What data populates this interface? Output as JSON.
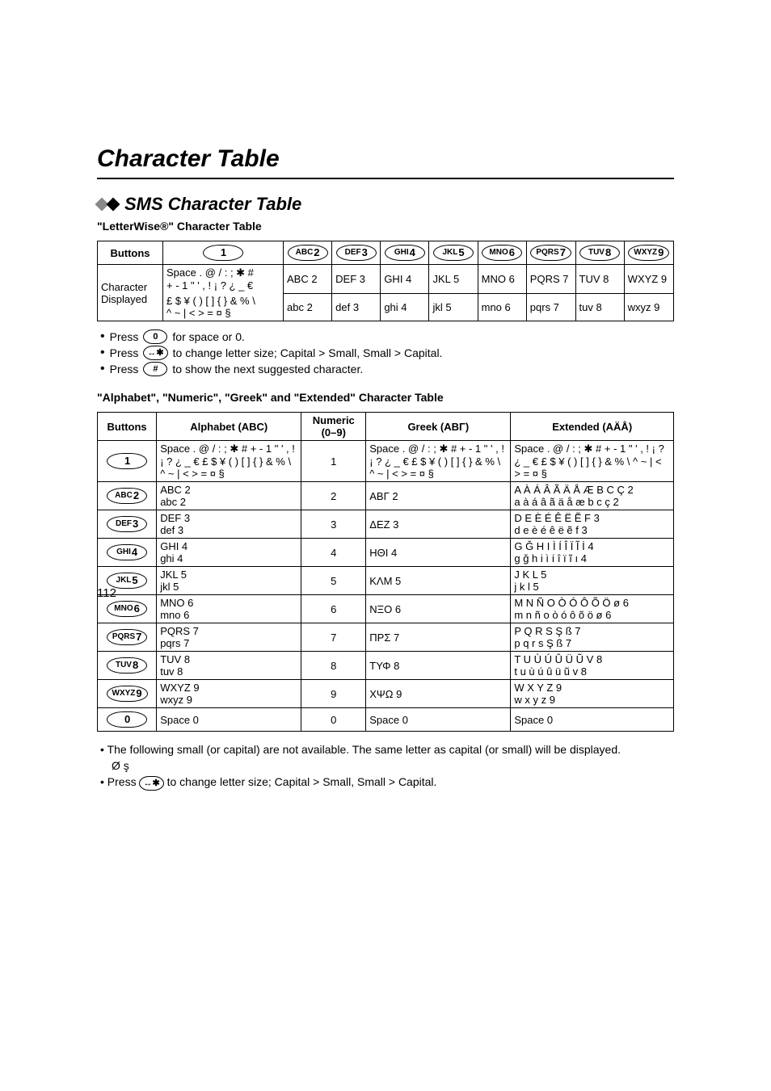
{
  "title": "Character Table",
  "section_title": "SMS Character Table",
  "lw_heading": "\"LetterWise®\" Character Table",
  "t1": {
    "header_buttons": "Buttons",
    "key_labels": [
      "1",
      "ABC 2",
      "DEF 3",
      "GHI 4",
      "JKL 5",
      "MNO 6",
      "PQRS 7",
      "TUV 8",
      "WXYZ 9"
    ],
    "row1_label": "Character Displayed",
    "row1_c1a": "Space . @ / : ; ✱ #",
    "row1_c1b": "+ - 1 \" ' , ! ¡ ? ¿ _ €",
    "row1_vals": [
      "ABC 2",
      "DEF 3",
      "GHI 4",
      "JKL 5",
      "MNO 6",
      "PQRS 7",
      "TUV 8",
      "WXYZ 9"
    ],
    "row2_c1a": "£ $ ¥ ( ) [ ] { } & % \\",
    "row2_c1b": "^ ~ | < > = ¤ §",
    "row2_vals": [
      "abc 2",
      "def 3",
      "ghi 4",
      "jkl 5",
      "mno 6",
      "pqrs 7",
      "tuv 8",
      "wxyz 9"
    ]
  },
  "notes_lw": {
    "n1a": "Press",
    "n1_key": "0",
    "n1b": "for space or 0.",
    "n2a": "Press",
    "n2_key": "↔✱",
    "n2b": "to change letter size; Capital > Small, Small > Capital.",
    "n3a": "Press",
    "n3_key": "#",
    "n3b": "to show the next suggested character."
  },
  "alpha_heading": "\"Alphabet\", \"Numeric\", \"Greek\" and \"Extended\" Character Table",
  "t2": {
    "h_buttons": "Buttons",
    "h_alpha": "Alphabet (ABC)",
    "h_num": "Numeric (0–9)",
    "h_greek": "Greek (ΑΒΓ)",
    "h_ext": "Extended (AÄÅ)",
    "rows": [
      {
        "key": "1",
        "alpha": "Space . @ / : ; ✱ # + - 1 \" ' , ! ¡ ? ¿ _ € £ $ ¥ ( ) [ ] { } & % \\ ^ ~ | < > = ¤ §",
        "num": "1",
        "greek": "Space . @ / : ; ✱ # + - 1 \" ' , ! ¡ ? ¿ _ € £ $ ¥ ( ) [ ] { } & % \\ ^ ~ | < > = ¤ §",
        "ext": "Space . @ / : ; ✱ # + - 1 \" ' , ! ¡ ? ¿ _ € £ $ ¥ ( ) [ ] { } & % \\ ^ ~ | < > = ¤ §"
      },
      {
        "key": "ABC 2",
        "alpha": "ABC 2\nabc 2",
        "num": "2",
        "greek": "ΑΒΓ 2",
        "ext": "A À Á Â Ã Ä Å Æ B C Ç 2\na à á â ã ä å æ b c ç 2"
      },
      {
        "key": "DEF 3",
        "alpha": "DEF 3\ndef 3",
        "num": "3",
        "greek": "ΔΕΖ 3",
        "ext": "D E È É Ê Ë Ẽ F 3\nd e è é ê ë ẽ f 3"
      },
      {
        "key": "GHI 4",
        "alpha": "GHI 4\nghi 4",
        "num": "4",
        "greek": "ΗΘΙ 4",
        "ext": "G Ğ H I Ì Í Î Ï Ĩ İ 4\ng ğ h i ì í î ï ĩ ı 4"
      },
      {
        "key": "JKL 5",
        "alpha": "JKL 5\njkl 5",
        "num": "5",
        "greek": "ΚΛΜ 5",
        "ext": "J K L 5\nj k l 5"
      },
      {
        "key": "MNO 6",
        "alpha": "MNO 6\nmno 6",
        "num": "6",
        "greek": "ΝΞΟ 6",
        "ext": "M N Ñ O Ò Ó Ô Õ Ö ø 6\nm n ñ o ò ó ô õ ö ø 6"
      },
      {
        "key": "PQRS 7",
        "alpha": "PQRS 7\npqrs 7",
        "num": "7",
        "greek": "ΠΡΣ 7",
        "ext": "P Q R S Ş ß 7\np q r s Ş ß 7"
      },
      {
        "key": "TUV 8",
        "alpha": "TUV 8\ntuv 8",
        "num": "8",
        "greek": "ΤΥΦ 8",
        "ext": "T U Ù Ú Û Ü Ũ V 8\nt u ù ú û ü ũ v 8"
      },
      {
        "key": "WXYZ 9",
        "alpha": "WXYZ 9\nwxyz 9",
        "num": "9",
        "greek": "ΧΨΩ 9",
        "ext": "W X Y Z 9\nw x y z 9"
      },
      {
        "key": "0",
        "alpha": "Space 0",
        "num": "0",
        "greek": "Space 0",
        "ext": "Space 0"
      }
    ]
  },
  "foot": {
    "p1": "The following small (or capital) are not available. The same letter as capital (or small) will be displayed.",
    "p1_sub": "Ø ş",
    "p2a": "Press",
    "p2_key": "↔✱",
    "p2b": "to change letter size; Capital > Small, Small > Capital."
  },
  "page_number": "112"
}
